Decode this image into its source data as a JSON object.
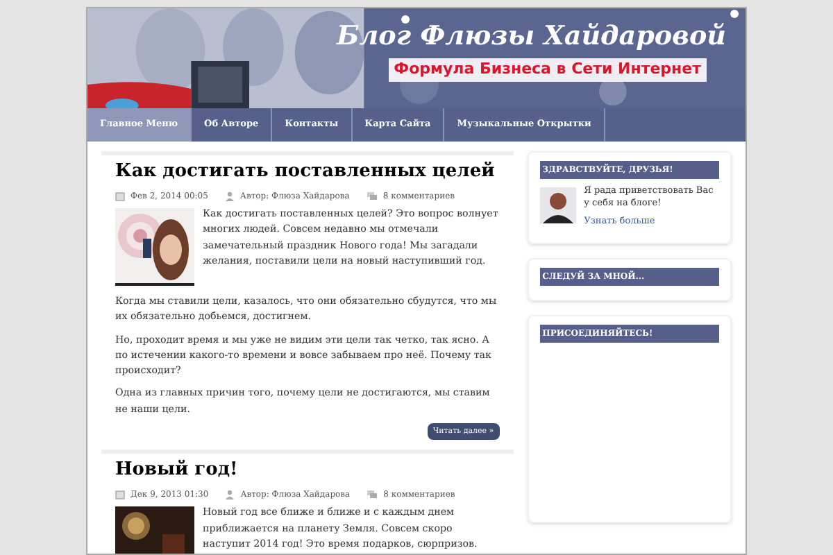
{
  "header": {
    "title": "Блог Флюзы Хайдаровой",
    "subtitle": "Формула Бизнеса в Сети Интернет"
  },
  "nav": [
    {
      "label": "Главное Меню",
      "selected": true
    },
    {
      "label": "Об Авторе",
      "selected": false
    },
    {
      "label": "Контакты",
      "selected": false
    },
    {
      "label": "Карта Сайта",
      "selected": false
    },
    {
      "label": "Музыкальные Открытки",
      "selected": false
    }
  ],
  "posts": [
    {
      "title": "Как достигать поставленных целей",
      "date": "Фев 2, 2014 00:05",
      "author": "Автор: Флюза Хайдарова",
      "comments": "8 комментариев",
      "paragraphs": [
        "Как достигать поставленных целей? Это вопрос волнует многих людей. Совсем недавно мы отмечали замечательный праздник Нового года! Мы загадали желания, поставили цели на новый наступивший год.",
        "Когда мы ставили цели, казалось, что они обязательно сбудутся, что мы их обязательно добьемся, достигнем.",
        "Но, проходит время и мы уже не видим эти цели так четко, так ясно. А по истечении какого-то времени и вовсе забываем про неё. Почему так происходит?",
        "Одна из главных причин того, почему цели не достигаются, мы ставим не наши цели."
      ],
      "more": "Читать далее »"
    },
    {
      "title": "Новый год!",
      "date": "Дек 9, 2013 01:30",
      "author": "Автор: Флюза Хайдарова",
      "comments": "8 комментариев",
      "paragraphs": [
        "Новый год все ближе и ближе и с каждым днем приближается на планету Земля. Совсем скоро наступит 2014 год! Это время подарков, сюрпризов."
      ]
    }
  ],
  "sidebar": [
    {
      "heading": "ЗДРАВСТВУЙТЕ, ДРУЗЬЯ!",
      "text": "Я рада приветствовать Вас у себя на блоге!",
      "link": "Узнать больше"
    },
    {
      "heading": "СЛЕДУЙ ЗА МНОЙ..."
    },
    {
      "heading": "ПРИСОЕДИНЯЙТЕСЬ!"
    }
  ]
}
